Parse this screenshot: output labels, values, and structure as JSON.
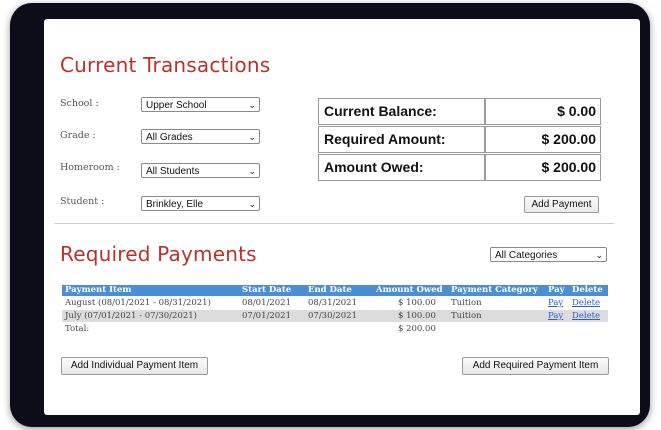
{
  "current": {
    "title": "Current Transactions",
    "filters": [
      {
        "label": "School :",
        "value": "Upper School"
      },
      {
        "label": "Grade :",
        "value": "All Grades"
      },
      {
        "label": "Homeroom :",
        "value": "All Students"
      },
      {
        "label": "Student :",
        "value": "Brinkley, Elle"
      }
    ],
    "balance": [
      {
        "label": "Current Balance:",
        "value": "$ 0.00"
      },
      {
        "label": "Required Amount:",
        "value": "$ 200.00"
      },
      {
        "label": "Amount Owed:",
        "value": "$ 200.00"
      }
    ],
    "add_payment_label": "Add Payment"
  },
  "required": {
    "title": "Required Payments",
    "category_filter": "All Categories",
    "columns": [
      "Payment Item",
      "Start Date",
      "End Date",
      "Amount Owed",
      "Payment Category",
      "Pay",
      "Delete"
    ],
    "rows": [
      {
        "item": "August (08/01/2021 - 08/31/2021)",
        "start": "08/01/2021",
        "end": "08/31/2021",
        "amount": "$ 100.00",
        "category": "Tuition",
        "pay": "Pay",
        "delete": "Delete"
      },
      {
        "item": "July (07/01/2021 - 07/30/2021)",
        "start": "07/01/2021",
        "end": "07/30/2021",
        "amount": "$ 100.00",
        "category": "Tuition",
        "pay": "Pay",
        "delete": "Delete"
      }
    ],
    "total_label": "Total:",
    "total_amount": "$ 200.00",
    "add_individual_label": "Add Individual Payment Item",
    "add_required_label": "Add Required Payment Item"
  },
  "colors": {
    "title": "#b8322a",
    "table_header": "#4a8fd4",
    "row_alt": "#dcdcdc",
    "link": "#2a5bd7",
    "device_frame": "#0d0d1a"
  },
  "icons": {
    "dropdown": "chevron-down-icon"
  }
}
